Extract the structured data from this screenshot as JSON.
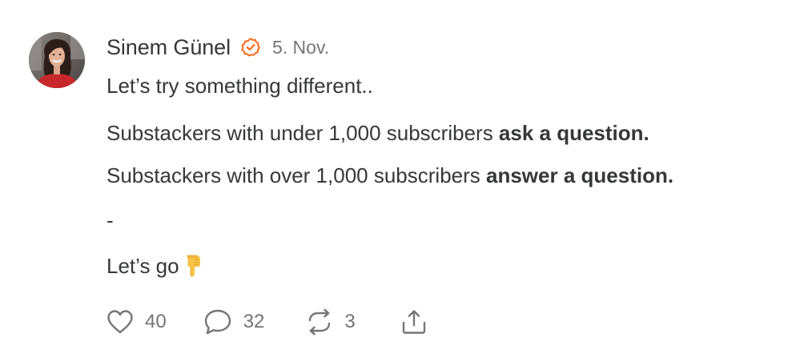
{
  "author": {
    "name": "Sinem Günel",
    "verified_icon": "verified-badge-icon",
    "avatar_icon": "profile-photo",
    "date": "5. Nov."
  },
  "post": {
    "line1": "Let’s try something different..",
    "line2_prefix": "Substackers with under 1,000 subscribers ",
    "line2_bold": "ask a question.",
    "line3_prefix": "Substackers with over 1,000 subscribers ",
    "line3_bold": "answer a question.",
    "line4": "-",
    "line5": "Let’s go",
    "emoji": "backhand-index-pointing-down-icon"
  },
  "actions": {
    "likes": "40",
    "comments": "32",
    "restacks": "3",
    "share_icon": "share-icon"
  },
  "colors": {
    "text": "#363737",
    "muted": "#757575",
    "accent": "#FF6719"
  }
}
